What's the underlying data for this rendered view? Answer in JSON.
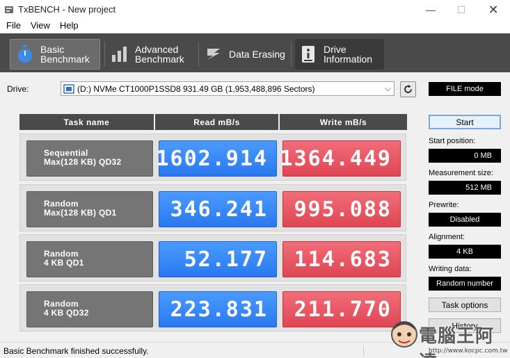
{
  "window": {
    "title": "TxBENCH - New project",
    "min_glyph": "—",
    "max_glyph": "☐",
    "close_glyph": "✕"
  },
  "menu": [
    "File",
    "View",
    "Help"
  ],
  "tabs": [
    {
      "line1": "Basic",
      "line2": "Benchmark",
      "icon": "stopwatch-icon",
      "active": true
    },
    {
      "line1": "Advanced",
      "line2": "Benchmark",
      "icon": "bar-chart-icon"
    },
    {
      "line1": "Data Erasing",
      "line2": "",
      "icon": "eraser-icon"
    },
    {
      "line1": "Drive",
      "line2": "Information",
      "icon": "info-icon"
    }
  ],
  "drive": {
    "label": "Drive:",
    "selected": "(D:) NVMe CT1000P1SSD8  931.49 GB (1,953,488,896 Sectors)"
  },
  "table": {
    "headers": [
      "Task name",
      "Read mB/s",
      "Write mB/s"
    ],
    "rows": [
      {
        "task_line1": "Sequential",
        "task_line2": "Max(128 KB) QD32",
        "read": "1602.914",
        "write": "1364.449"
      },
      {
        "task_line1": "Random",
        "task_line2": "Max(128 KB) QD1",
        "read": "346.241",
        "write": "995.088"
      },
      {
        "task_line1": "Random",
        "task_line2": "4 KB QD1",
        "read": "52.177",
        "write": "114.683"
      },
      {
        "task_line1": "Random",
        "task_line2": "4 KB QD32",
        "read": "223.831",
        "write": "211.770"
      }
    ]
  },
  "right_panel": {
    "mode": "FILE mode",
    "start_button": "Start",
    "start_position_label": "Start position:",
    "start_position_value": "0 MB",
    "measurement_size_label": "Measurement size:",
    "measurement_size_value": "512 MB",
    "prewrite_label": "Prewrite:",
    "prewrite_value": "Disabled",
    "alignment_label": "Alignment:",
    "alignment_value": "4 KB",
    "writing_data_label": "Writing data:",
    "writing_data_value": "Random number",
    "task_options_button": "Task options",
    "history_button": "History"
  },
  "status": {
    "text": "Basic Benchmark finished successfully."
  },
  "watermark": {
    "text": "電腦王阿達",
    "url": "http://www.kocpc.com.tw"
  },
  "colors": {
    "toolbar": "#4a4a4a",
    "read": "#2f80f5",
    "write": "#e55360"
  }
}
